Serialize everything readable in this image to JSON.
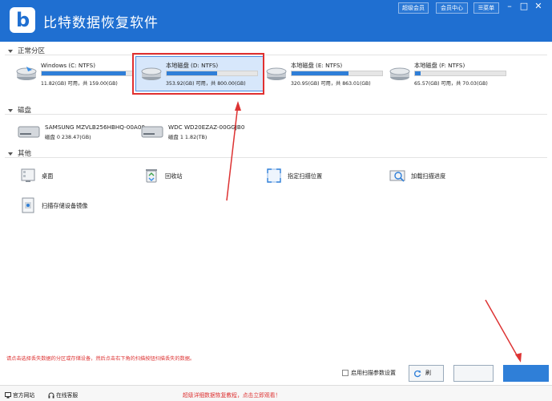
{
  "app": {
    "title": "比特数据恢复软件",
    "logo_letter": "b",
    "vip_button": "超级会员",
    "member_center_button": "会员中心",
    "menu_button": "☰菜单"
  },
  "sections": {
    "partitions": {
      "label": "正常分区"
    },
    "disks": {
      "label": "磁盘"
    },
    "others": {
      "label": "其他"
    }
  },
  "drives": [
    {
      "name": "Windows (C: NTFS)",
      "info": "11.82(GB) 可用，共 159.00(GB)",
      "used_fraction": 0.93,
      "selected": false
    },
    {
      "name": "本地磁盘 (D: NTFS)",
      "info": "353.92(GB) 可用，共 800.00(GB)",
      "used_fraction": 0.56,
      "selected": true
    },
    {
      "name": "本地磁盘 (E: NTFS)",
      "info": "320.95(GB) 可用，共 863.01(GB)",
      "used_fraction": 0.63,
      "selected": false
    },
    {
      "name": "本地磁盘 (F: NTFS)",
      "info": "65.57(GB) 可用，共 70.03(GB)",
      "used_fraction": 0.06,
      "selected": false
    }
  ],
  "disks": [
    {
      "name": "SAMSUNG MZVLB256HBHQ-00A00",
      "info": "磁盘 0    238.47(GB)"
    },
    {
      "name": "WDC WD20EZAZ-00GGJB0",
      "info": "磁盘 1    1.82(TB)"
    }
  ],
  "others": [
    {
      "label": "桌面",
      "icon": "desktop-icon"
    },
    {
      "label": "回收站",
      "icon": "recycle-bin-icon"
    },
    {
      "label": "指定扫描位置",
      "icon": "scan-location-icon"
    },
    {
      "label": "加载扫描进度",
      "icon": "load-progress-icon"
    },
    {
      "label": "扫描存储设备镜像",
      "icon": "disk-image-icon"
    }
  ],
  "footer": {
    "hint": "请点击选择丢失数据的分区或存储设备，然后点击右下角的扫描按钮扫描丢失的数据。",
    "enable_filter_label": "启用扫描参数设置",
    "refresh_button": "刷",
    "official_site": "官方网站",
    "online_support": "在线客服",
    "promo": "超级详细数据恢复教程，点击立即观看！"
  },
  "colors": {
    "titlebar": "#1f6fd1",
    "bar_fill": "#2f7fd8",
    "hint_red": "#dd3333"
  }
}
